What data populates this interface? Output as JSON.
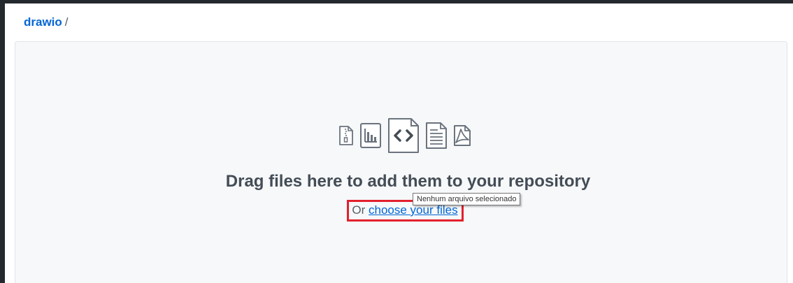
{
  "breadcrumb": {
    "repo": "drawio",
    "separator": "/"
  },
  "dropzone": {
    "icons": [
      "file-zip-icon",
      "file-chart-icon",
      "file-code-icon",
      "file-text-icon",
      "file-pdf-icon"
    ],
    "headline": "Drag files here to add them to your repository",
    "prefix": "Or",
    "link": "choose your files",
    "tooltip": "Nenhum arquivo selecionado"
  },
  "colors": {
    "link": "#0366d6",
    "highlight": "#e3202d",
    "dropzone_bg": "#f6f8fa",
    "outer_bg": "#24292e"
  }
}
